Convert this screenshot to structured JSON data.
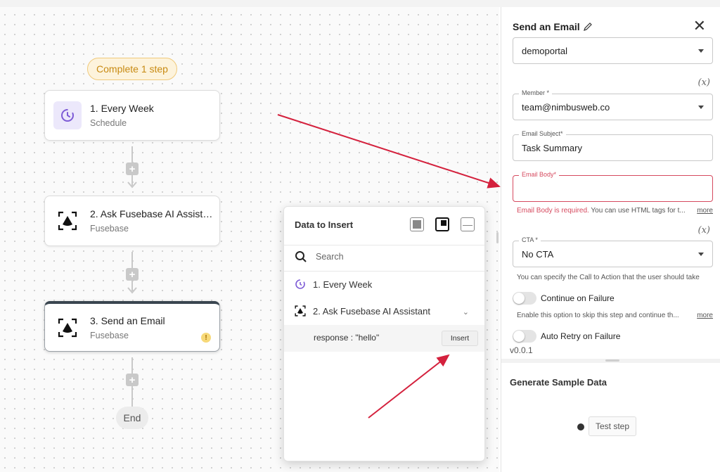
{
  "canvas": {
    "badge": "Complete 1 step",
    "steps": [
      {
        "title": "1. Every Week",
        "subtitle": "Schedule"
      },
      {
        "title": "2. Ask Fusebase AI Assistant",
        "subtitle": "Fusebase"
      },
      {
        "title": "3. Send an Email",
        "subtitle": "Fusebase"
      }
    ],
    "end_label": "End"
  },
  "data_popup": {
    "title": "Data to Insert",
    "search_placeholder": "Search",
    "items": [
      {
        "label": "1. Every Week"
      },
      {
        "label": "2. Ask Fusebase AI Assistant"
      }
    ],
    "response_label": "response : \"hello\"",
    "insert_label": "Insert"
  },
  "panel": {
    "title": "Send an Email",
    "fields": {
      "portal": {
        "value": "demoportal"
      },
      "member": {
        "label": "Member *",
        "value": "team@nimbusweb.co"
      },
      "subject": {
        "label": "Email Subject*",
        "value": "Task Summary"
      },
      "body": {
        "label": "Email Body*",
        "value": ""
      },
      "cta": {
        "label": "CTA *",
        "value": "No CTA"
      }
    },
    "fx_label": "(x)",
    "body_error": "Email Body is required.",
    "body_help": " You can use HTML tags for t...",
    "more_label": "more",
    "cta_help": "You can specify the Call to Action that the user should take",
    "continue_label": "Continue on Failure",
    "continue_help": "Enable this option to skip this step and continue th...",
    "retry_label": "Auto Retry on Failure",
    "version": "v0.0.1",
    "generate_title": "Generate Sample Data",
    "test_step_label": "Test step"
  },
  "colors": {
    "badge_bg": "#fdf3dc",
    "badge_text": "#c88a12",
    "error": "#d64a5f",
    "annotation_arrow": "#d4213d",
    "schedule_icon": "#7d5bd6"
  }
}
